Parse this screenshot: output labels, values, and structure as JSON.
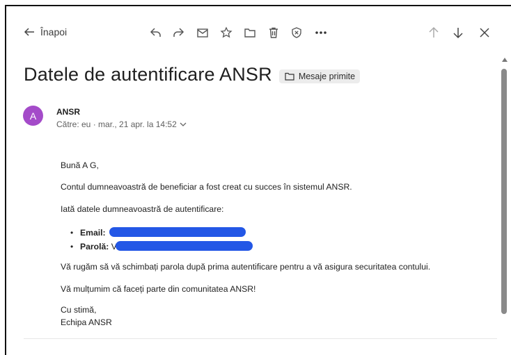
{
  "toolbar": {
    "back_label": "Înapoi",
    "icons": [
      "reply-icon",
      "forward-icon",
      "mark-unread-icon",
      "star-icon",
      "folder-icon",
      "delete-icon",
      "block-icon",
      "more-icon",
      "previous-icon",
      "next-icon",
      "close-icon"
    ]
  },
  "message": {
    "subject": "Datele de autentificare ANSR",
    "folder": "Mesaje primite",
    "avatar_initial": "A",
    "sender": "ANSR",
    "recipient_line": "Către: eu · mar., 21 apr. la 14:52",
    "body": {
      "greeting": "Bună A G,",
      "line1": "Contul dumneavoastră de beneficiar a fost creat cu succes în sistemul ANSR.",
      "line2": "Iată datele dumneavoastră de autentificare:",
      "email_key": "Email:",
      "password_key": "Parolă:",
      "password_visible_prefix": "V",
      "line3": "Vă rugăm să vă schimbați parola după prima autentificare pentru a vă asigura securitatea contului.",
      "line4": "Vă mulțumim că faceți parte din comunitatea ANSR!",
      "signoff": "Cu stimă,",
      "signature": "Echipa ANSR"
    }
  },
  "colors": {
    "avatar": "#a44bc9",
    "redaction": "#2357e6",
    "scrollbar": "#8a8a8a"
  }
}
